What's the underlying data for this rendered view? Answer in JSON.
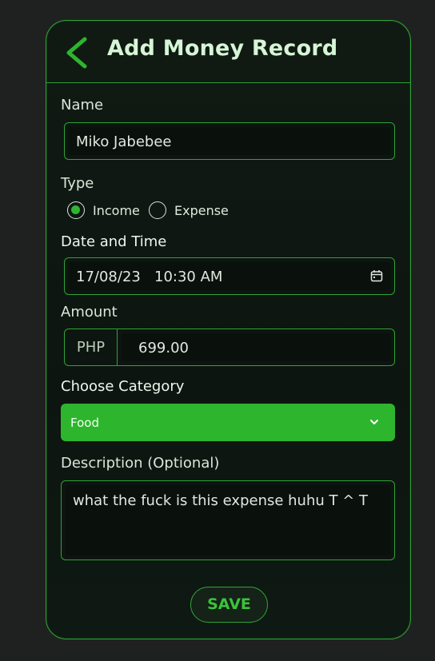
{
  "header": {
    "title": "Add Money Record",
    "back_icon": "chevron-left-icon"
  },
  "form": {
    "name": {
      "label": "Name",
      "value": "Miko Jabebee"
    },
    "type": {
      "label": "Type",
      "options": [
        {
          "label": "Income",
          "selected": true
        },
        {
          "label": "Expense",
          "selected": false
        }
      ]
    },
    "datetime": {
      "label": "Date and Time",
      "value": "17/08/23   10:30 AM",
      "icon": "calendar-icon"
    },
    "amount": {
      "label": "Amount",
      "currency": "PHP",
      "value": "699.00"
    },
    "category": {
      "label": "Choose Category",
      "value": "Food",
      "icon": "chevron-down-icon"
    },
    "description": {
      "label": "Description (Optional)",
      "value": "what the fuck is this expense huhu T ^ T"
    }
  },
  "actions": {
    "save_label": "SAVE"
  },
  "colors": {
    "accent": "#2db52d",
    "border": "#2fa336",
    "background": "#1f2120",
    "card": "#0e1611"
  }
}
